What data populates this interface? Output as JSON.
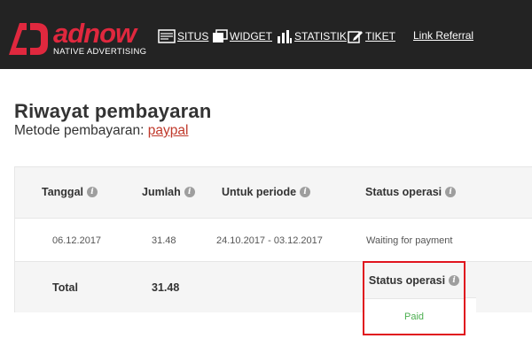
{
  "brand": {
    "word": "adnow",
    "tagline": "NATIVE ADVERTISING",
    "accent": "#e0283e"
  },
  "nav": {
    "situs": "SITUS",
    "widget": "WIDGET",
    "statistik": "STATISTIK",
    "tiket": "TIKET",
    "referral": "Link Referral"
  },
  "page": {
    "title": "Riwayat pembayaran",
    "method_label": "Metode pembayaran:",
    "method_value": "paypal"
  },
  "table": {
    "headers": [
      "Tanggal",
      "Jumlah",
      "Untuk periode",
      "Status operasi"
    ],
    "row": {
      "date": "06.12.2017",
      "amount": "31.48",
      "period": "24.10.2017 - 03.12.2017",
      "status": "Waiting for payment"
    },
    "total": {
      "label": "Total",
      "amount": "31.48"
    }
  },
  "highlight": {
    "header": "Status operasi",
    "status": "Paid",
    "status_color": "#4caf50",
    "border_color": "#e0141e"
  }
}
